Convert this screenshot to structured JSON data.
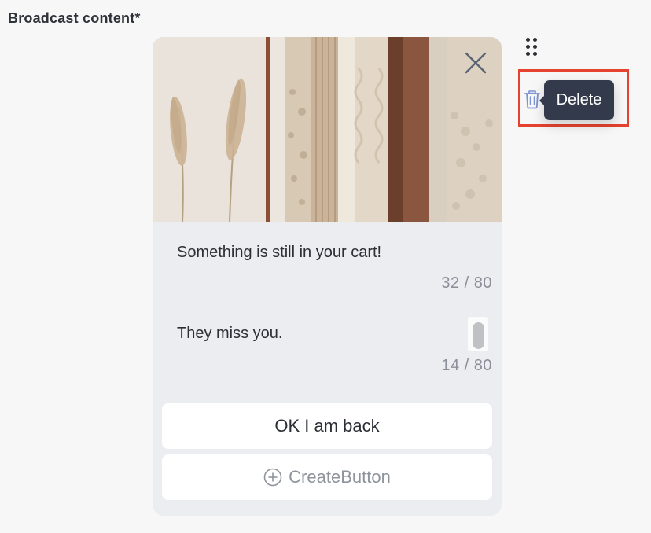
{
  "broadcast": {
    "label": "Broadcast content*"
  },
  "card": {
    "image_alt": "clothes-rack-photo",
    "title_text": "Something is still in your cart!",
    "title_counter": "32 / 80",
    "body_text": "They miss you.",
    "body_counter": "14 / 80",
    "buttons": [
      {
        "label": "OK I am back"
      }
    ],
    "create_button_label": "CreateButton"
  },
  "actions": {
    "delete_tooltip": "Delete",
    "icons": [
      "drag-handle-icon",
      "trash-icon",
      "close-icon",
      "plus-circle-icon"
    ]
  },
  "colors": {
    "highlight": "#e5432f",
    "tooltip_bg": "#333a4b",
    "trash_icon": "#7a93d1"
  }
}
